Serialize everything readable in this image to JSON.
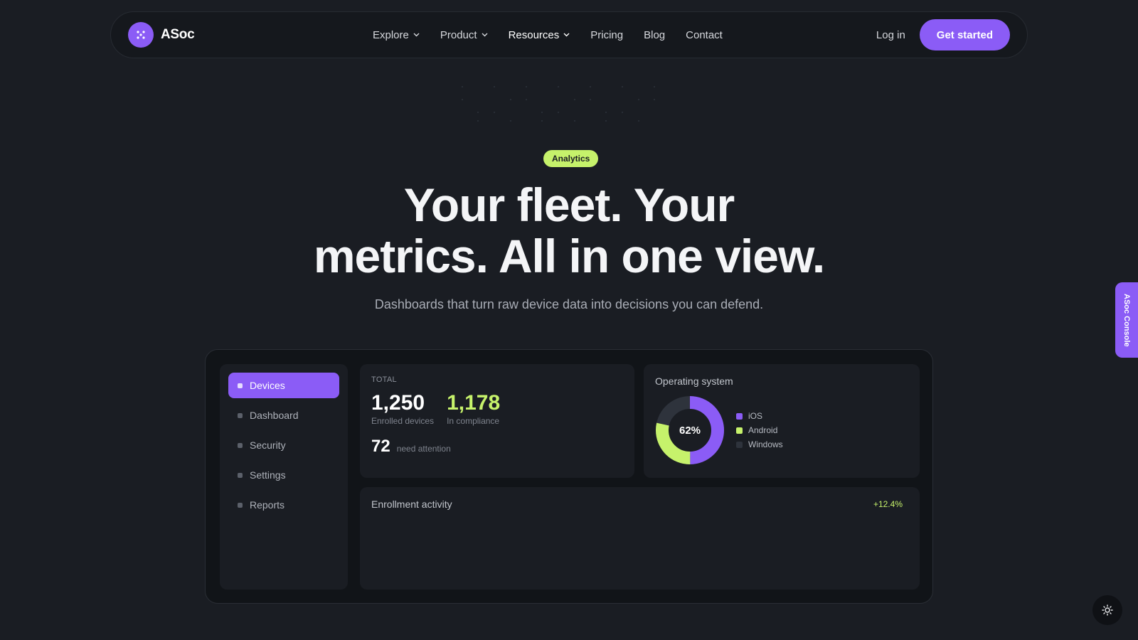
{
  "nav": {
    "brand": "ASoc",
    "links": [
      "Explore",
      "Product",
      "Resources",
      "Pricing",
      "Blog",
      "Contact"
    ],
    "login": "Log in",
    "cta": "Get started"
  },
  "hero": {
    "badge": "Analytics",
    "headline_line1": "Your fleet. Your",
    "headline_line2": "metrics. All in one view.",
    "subhead": "Dashboards that turn raw device data into decisions you can defend."
  },
  "dashboard": {
    "sidebar": [
      "Devices",
      "Dashboard",
      "Security",
      "Settings",
      "Reports"
    ],
    "total": {
      "label": "TOTAL",
      "enrolled_value": "1,250",
      "enrolled_caption": "Enrolled devices",
      "compliance_value": "1,178",
      "compliance_caption": "In compliance",
      "attention_value": "72",
      "attention_caption": "need attention"
    },
    "os": {
      "title": "Operating system",
      "center_label": "62%",
      "legend": [
        "iOS",
        "Android",
        "Windows"
      ],
      "colors": [
        "#8b5cf6",
        "#c6f26b",
        "#2e333c"
      ]
    },
    "activity": {
      "title": "Enrollment activity",
      "delta": "+12.4%"
    }
  },
  "console_tab": "ASoc Console",
  "icons": {
    "logo": "dots-logo-icon",
    "chevron": "chevron-down-icon",
    "theme": "sun-icon"
  }
}
